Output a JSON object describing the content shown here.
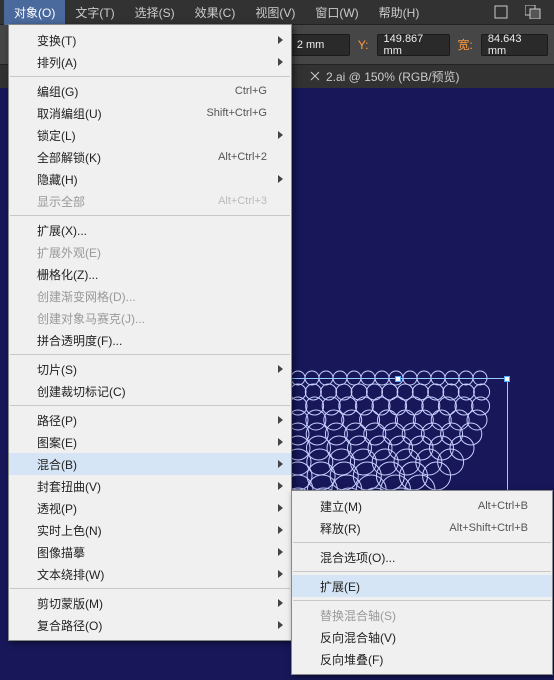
{
  "menubar": {
    "items": [
      "对象(O)",
      "文字(T)",
      "选择(S)",
      "效果(C)",
      "视图(V)",
      "窗口(W)",
      "帮助(H)"
    ],
    "active_index": 0
  },
  "options_bar": {
    "x_suffix": "2 mm",
    "y_label": "Y:",
    "y_value": "149.867 mm",
    "w_label": "宽:",
    "w_value": "84.643 mm"
  },
  "tab": {
    "label": "2.ai @ 150% (RGB/预览)"
  },
  "dropdown": {
    "groups": [
      [
        {
          "label": "变换(T)",
          "arrow": true
        },
        {
          "label": "排列(A)",
          "arrow": true
        }
      ],
      [
        {
          "label": "编组(G)",
          "shortcut": "Ctrl+G"
        },
        {
          "label": "取消编组(U)",
          "shortcut": "Shift+Ctrl+G"
        },
        {
          "label": "锁定(L)",
          "arrow": true
        },
        {
          "label": "全部解锁(K)",
          "shortcut": "Alt+Ctrl+2"
        },
        {
          "label": "隐藏(H)",
          "arrow": true
        },
        {
          "label": "显示全部",
          "shortcut": "Alt+Ctrl+3",
          "disabled": true
        }
      ],
      [
        {
          "label": "扩展(X)..."
        },
        {
          "label": "扩展外观(E)",
          "disabled": true
        },
        {
          "label": "栅格化(Z)..."
        },
        {
          "label": "创建渐变网格(D)...",
          "disabled": true
        },
        {
          "label": "创建对象马赛克(J)...",
          "disabled": true
        },
        {
          "label": "拼合透明度(F)..."
        }
      ],
      [
        {
          "label": "切片(S)",
          "arrow": true
        },
        {
          "label": "创建裁切标记(C)"
        }
      ],
      [
        {
          "label": "路径(P)",
          "arrow": true
        },
        {
          "label": "图案(E)",
          "arrow": true
        },
        {
          "label": "混合(B)",
          "arrow": true,
          "highlight": true
        },
        {
          "label": "封套扭曲(V)",
          "arrow": true
        },
        {
          "label": "透视(P)",
          "arrow": true
        },
        {
          "label": "实时上色(N)",
          "arrow": true
        },
        {
          "label": "图像描摹",
          "arrow": true
        },
        {
          "label": "文本绕排(W)",
          "arrow": true
        }
      ],
      [
        {
          "label": "剪切蒙版(M)",
          "arrow": true
        },
        {
          "label": "复合路径(O)",
          "arrow": true
        }
      ]
    ]
  },
  "submenu": {
    "groups": [
      [
        {
          "label": "建立(M)",
          "shortcut": "Alt+Ctrl+B"
        },
        {
          "label": "释放(R)",
          "shortcut": "Alt+Shift+Ctrl+B"
        }
      ],
      [
        {
          "label": "混合选项(O)..."
        }
      ],
      [
        {
          "label": "扩展(E)",
          "highlight": true
        }
      ],
      [
        {
          "label": "替换混合轴(S)",
          "disabled": true
        },
        {
          "label": "反向混合轴(V)"
        },
        {
          "label": "反向堆叠(F)"
        }
      ]
    ]
  }
}
